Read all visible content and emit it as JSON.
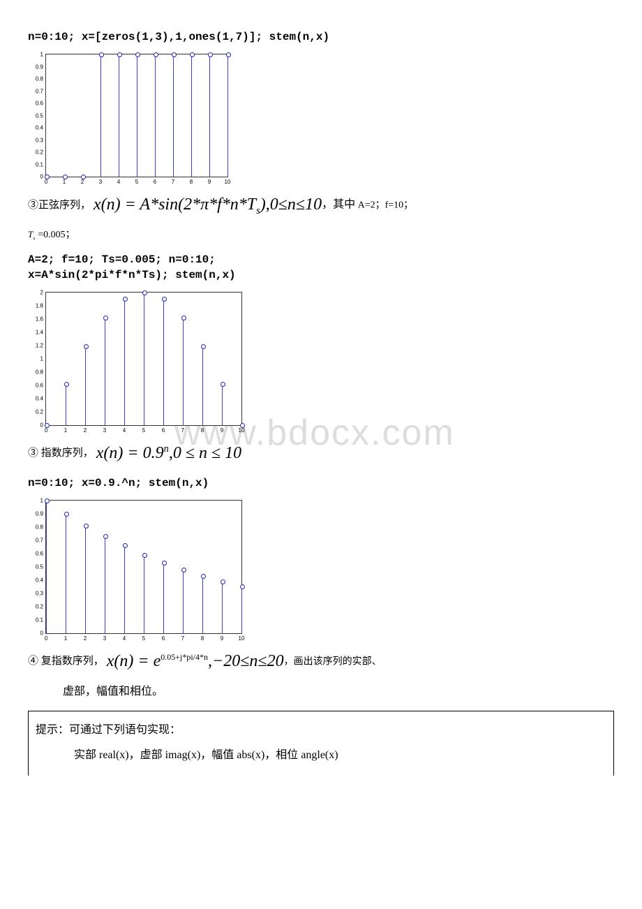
{
  "code1": "n=0:10;   x=[zeros(1,3),1,ones(1,7)];   stem(n,x)",
  "line2a": "③正弦序列，",
  "formula2": "x(n) = A*sin(2*π*f*n*T",
  "formula2b": "),0≤n≤10",
  "line2c": "，其中",
  "line2d": " A=2；f=10；",
  "line2e": "=0.005；",
  "code2a": "A=2;  f=10;  Ts=0.005;   n=0:10;",
  "code2b": "x=A*sin(2*pi*f*n*Ts);    stem(n,x)",
  "line3a": "③ 指数序列，",
  "formula3": "x(n) = 0.9",
  "formula3b": ",0 ≤ n ≤ 10",
  "code3": "n=0:10;  x=0.9.^n;  stem(n,x)",
  "line4a": "④ 复指数序列，",
  "formula4": "x(n) = e",
  "formula4sup": "0.05+j*pi/4*n",
  "formula4b": ",−20≤n≤20",
  "line4c": "，画出该序列的实部、",
  "line4d": "虚部，幅值和相位。",
  "hint1": "提示：可通过下列语句实现：",
  "hint2": "实部 real(x)，虚部 imag(x)，幅值 abs(x)，相位 angle(x)",
  "watermark": "www.bdocx.com",
  "chart_data": [
    {
      "type": "bar",
      "categories": [
        0,
        1,
        2,
        3,
        4,
        5,
        6,
        7,
        8,
        9,
        10
      ],
      "values": [
        0,
        0,
        0,
        1,
        1,
        1,
        1,
        1,
        1,
        1,
        1
      ],
      "xlabel": "",
      "ylabel": "",
      "ylim": [
        0,
        1
      ],
      "yticks": [
        0,
        0.1,
        0.2,
        0.3,
        0.4,
        0.5,
        0.6,
        0.7,
        0.8,
        0.9,
        1
      ]
    },
    {
      "type": "bar",
      "categories": [
        0,
        1,
        2,
        3,
        4,
        5,
        6,
        7,
        8,
        9,
        10
      ],
      "values": [
        0,
        0.62,
        1.18,
        1.62,
        1.9,
        2.0,
        1.9,
        1.62,
        1.18,
        0.62,
        0
      ],
      "xlabel": "",
      "ylabel": "",
      "ylim": [
        0,
        2
      ],
      "yticks": [
        0,
        0.2,
        0.4,
        0.6,
        0.8,
        1,
        1.2,
        1.4,
        1.6,
        1.8,
        2
      ]
    },
    {
      "type": "bar",
      "categories": [
        0,
        1,
        2,
        3,
        4,
        5,
        6,
        7,
        8,
        9,
        10
      ],
      "values": [
        1,
        0.9,
        0.81,
        0.73,
        0.66,
        0.59,
        0.53,
        0.48,
        0.43,
        0.39,
        0.35
      ],
      "xlabel": "",
      "ylabel": "",
      "ylim": [
        0,
        1
      ],
      "yticks": [
        0,
        0.1,
        0.2,
        0.3,
        0.4,
        0.5,
        0.6,
        0.7,
        0.8,
        0.9,
        1
      ]
    }
  ]
}
